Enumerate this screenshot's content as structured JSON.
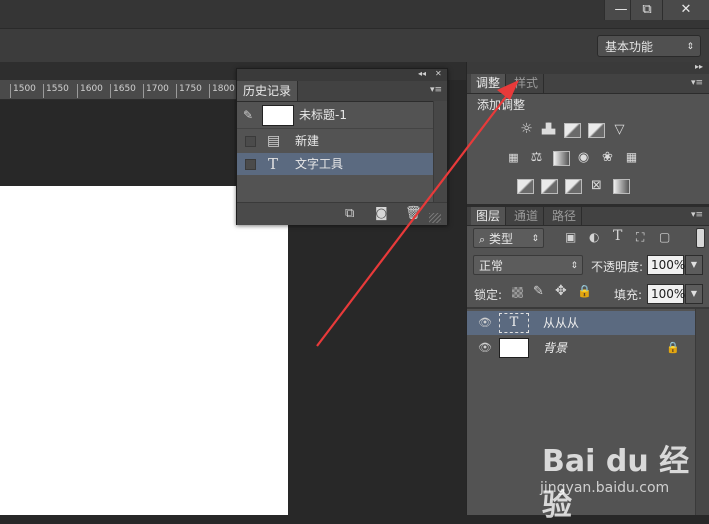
{
  "window": {
    "minimize_glyph": "—",
    "restore_glyph": "⧉",
    "close_glyph": "✕"
  },
  "options_bar": {
    "workspace_label": "基本功能",
    "dropdown_glyph": "⇕"
  },
  "ruler": {
    "ticks": [
      "1500",
      "1550",
      "1600",
      "1650",
      "1700",
      "1750",
      "1800"
    ]
  },
  "history_panel": {
    "title": "历史记录",
    "collapse_glyph": "◂◂",
    "close_glyph": "✕",
    "menu_glyph": "▾≡",
    "snapshot_name": "未标题-1",
    "items": [
      {
        "label": "新建",
        "icon": "document-icon"
      },
      {
        "label": "文字工具",
        "icon": "type-tool-icon",
        "selected": true
      }
    ],
    "footer_icons": [
      "new-document-from-state-icon",
      "camera-icon",
      "trash-icon"
    ]
  },
  "adjustments_panel": {
    "tabs": [
      "调整",
      "样式"
    ],
    "active_tab": "调整",
    "title": "添加调整",
    "expand_glyph": "▸▸",
    "menu_glyph": "▾≡"
  },
  "layers_panel": {
    "tabs": [
      "图层",
      "通道",
      "路径"
    ],
    "active_tab": "图层",
    "menu_glyph": "▾≡",
    "filter_label": "类型",
    "blend_mode": "正常",
    "opacity_label": "不透明度:",
    "opacity_value": "100%",
    "lock_label": "锁定:",
    "fill_label": "填充:",
    "fill_value": "100%",
    "layers": [
      {
        "name": "从从从",
        "kind": "text",
        "thumb_glyph": "T",
        "selected": true
      },
      {
        "name": "背景",
        "kind": "background",
        "locked": true
      }
    ]
  },
  "watermark": {
    "brand": "Bai du 经验",
    "url": "jingyan.baidu.com"
  },
  "colors": {
    "selection": "#5b6a80",
    "panel": "#535353",
    "arrow": "#e83a3a"
  }
}
